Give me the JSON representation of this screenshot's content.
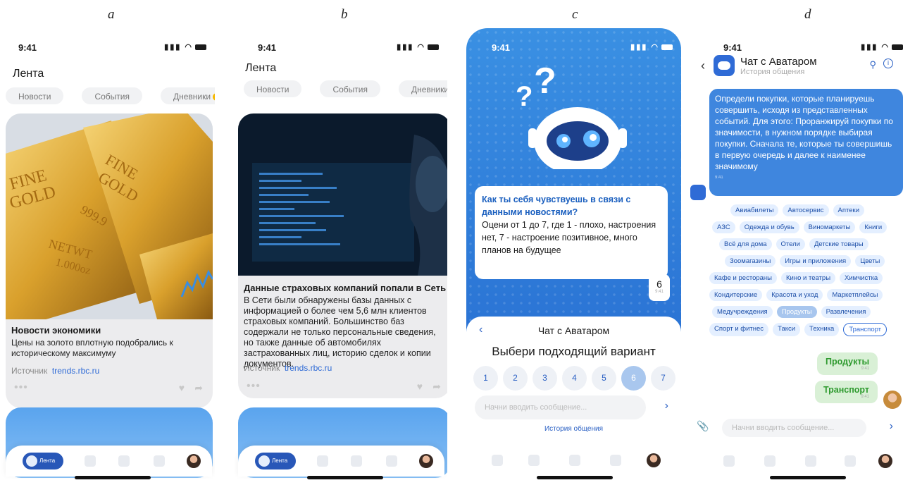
{
  "labels": {
    "a": "a",
    "b": "b",
    "c": "c",
    "d": "d"
  },
  "status_time": "9:41",
  "feed": {
    "title": "Лента",
    "tabs": [
      "Новости",
      "События",
      "Дневники"
    ],
    "diary_badge": "3",
    "source_label": "Источник",
    "source_link": "trends.rbc.ru",
    "nav_active": "Лента"
  },
  "panel_a": {
    "card_title": "Новости экономики",
    "card_text": "Цены на золото вплотную подобрались к историческому максимуму",
    "image_words": [
      "FINE",
      "GOLD",
      "999.9",
      "NETWT",
      "1.000oz"
    ]
  },
  "panel_b": {
    "card_title": "Данные страховых компаний попали в Сеть",
    "card_text": "В Сети были обнаружены базы данных с информацией о более чем 5,6 млн клиентов страховых компаний. Большинство баз содержали не только персональные сведения, но также данные об автомобилях застрахованных лиц, историю сделок и копии документов."
  },
  "panel_c": {
    "question_title": "Как ты себя чувствуешь в связи с данными новостями?",
    "question_text": "Оцени от 1 до 7, где 1 - плохо, настроения нет, 7 - настроение позитивное, много планов на будущее",
    "answer": "6",
    "msg_time": "9:41",
    "sheet_title": "Чат с Аватаром",
    "pick_label": "Выбери подходящий вариант",
    "options": [
      "1",
      "2",
      "3",
      "4",
      "5",
      "6",
      "7"
    ],
    "selected": "6",
    "input_placeholder": "Начни вводить сообщение...",
    "history_link": "История общения"
  },
  "panel_d": {
    "chat_title": "Чат с Аватаром",
    "chat_subtitle": "История общения",
    "bot_message": "Определи покупки, которые планируешь совершить, исходя из представленных событий. Для этого: Проранжируй покупки по значимости, в нужном порядке выбирая покупки. Сначала те, которые ты совершишь в первую очередь и далее к наименее значимому",
    "msg_time": "9:41",
    "chips": [
      [
        "Авиабилеты",
        "Автосервис",
        "Аптеки"
      ],
      [
        "АЗС",
        "Одежда и обувь",
        "Виномаркеты",
        "Книги"
      ],
      [
        "Всё для дома",
        "Отели",
        "Детские товары"
      ],
      [
        "Зоомагазины",
        "Игры и приложения",
        "Цветы"
      ],
      [
        "Кафе и рестораны",
        "Кино и театры",
        "Химчистка"
      ],
      [
        "Кондитерские",
        "Красота и уход",
        "Маркетплейсы"
      ],
      [
        "Медучреждения",
        "Продукты",
        "Развлечения"
      ],
      [
        "Спорт и фитнес",
        "Такси",
        "Техника",
        "Транспорт"
      ]
    ],
    "chip_selected": "Продукты",
    "chip_outlined": "Транспорт",
    "reply_1": "Продукты",
    "reply_2": "Транспорт",
    "input_placeholder": "Начни вводить сообщение..."
  }
}
